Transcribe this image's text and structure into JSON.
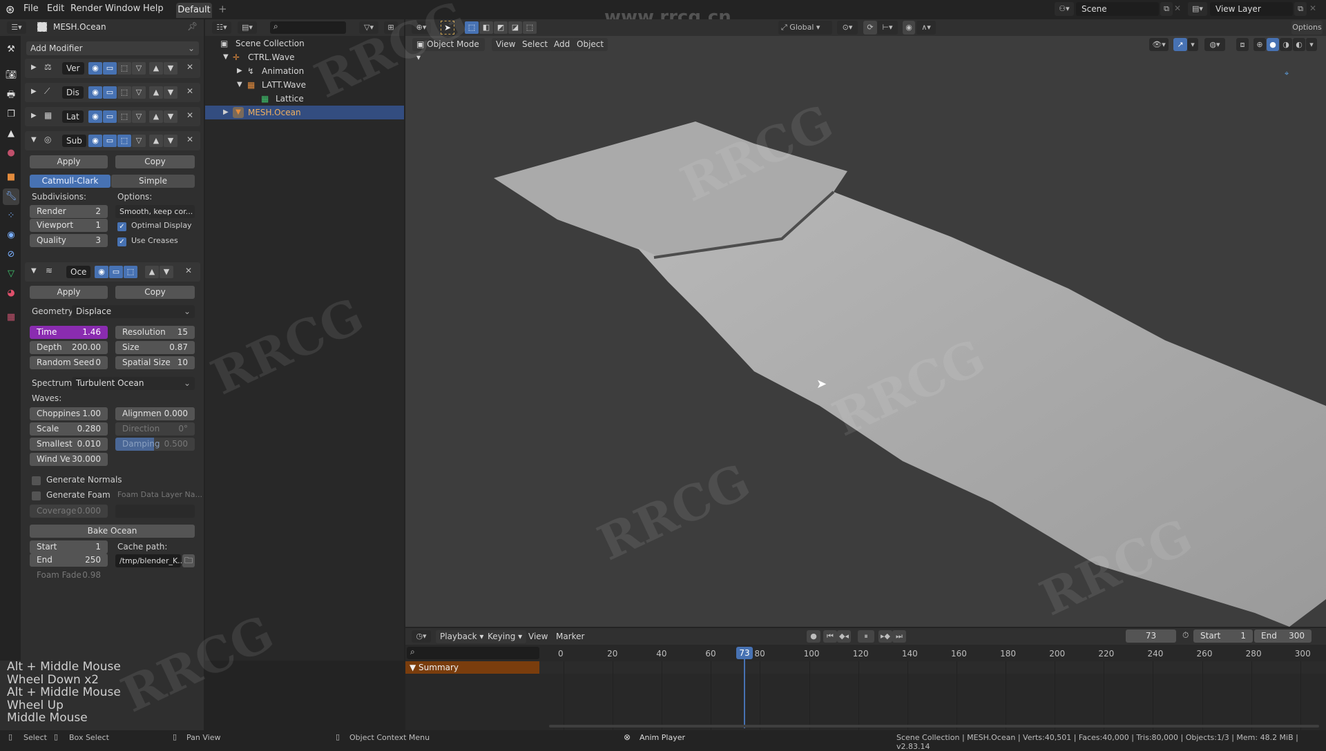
{
  "topbar": {
    "menus": [
      "File",
      "Edit",
      "Render",
      "Window",
      "Help"
    ],
    "workspace_tab": "Default",
    "add_workspace": "+",
    "scene": "Scene",
    "view_layer": "View Layer",
    "watermark_url": "www.rrcg.cn"
  },
  "properties": {
    "object_name": "MESH.Ocean",
    "add_modifier": "Add Modifier",
    "tabs": [
      "tool",
      "render",
      "output",
      "view-layer",
      "scene",
      "world",
      "object",
      "modifiers",
      "particles",
      "physics",
      "constraints",
      "data",
      "material",
      "texture"
    ],
    "modifiers": [
      {
        "name": "Ver",
        "icon": "vertex-weight-icon",
        "expanded": false
      },
      {
        "name": "Dis",
        "icon": "displace-icon",
        "expanded": false
      },
      {
        "name": "Lat",
        "icon": "lattice-icon",
        "expanded": false
      },
      {
        "name": "Sub",
        "icon": "subdivision-icon",
        "expanded": true
      },
      {
        "name": "Oce",
        "icon": "ocean-icon",
        "expanded": true
      }
    ],
    "subsurf": {
      "apply": "Apply",
      "copy": "Copy",
      "type_catmull": "Catmull-Clark",
      "type_simple": "Simple",
      "subdivisions_label": "Subdivisions:",
      "options_label": "Options:",
      "render_label": "Render",
      "render_value": "2",
      "viewport_label": "Viewport",
      "viewport_value": "1",
      "quality_label": "Quality",
      "quality_value": "3",
      "uv_smooth": "Smooth, keep cor...",
      "optimal_display": "Optimal Display",
      "use_creases": "Use Creases"
    },
    "ocean": {
      "apply": "Apply",
      "copy": "Copy",
      "geometry_label": "Geometry:",
      "geometry_value": "Displace",
      "time_label": "Time",
      "time_value": "1.46",
      "depth_label": "Depth",
      "depth_value": "200.00",
      "seed_label": "Random Seed",
      "seed_value": "0",
      "resolution_label": "Resolution",
      "resolution_value": "15",
      "size_label": "Size",
      "size_value": "0.87",
      "spatial_label": "Spatial Size",
      "spatial_value": "10",
      "spectrum_label": "Spectrum:",
      "spectrum_value": "Turbulent Ocean",
      "waves_label": "Waves:",
      "choppiness_label": "Choppines",
      "choppiness_value": "1.00",
      "scale_label": "Scale",
      "scale_value": "0.280",
      "smallest_label": "Smallest",
      "smallest_value": "0.010",
      "wind_label": "Wind Ve",
      "wind_value": "30.000",
      "alignment_label": "Alignmen",
      "alignment_value": "0.000",
      "direction_label": "Direction",
      "direction_value": "0°",
      "damping_label": "Damping",
      "damping_value": "0.500",
      "gen_normals": "Generate Normals",
      "gen_foam": "Generate Foam",
      "foam_layer_placeholder": "Foam Data Layer Na...",
      "coverage_label": "Coverage",
      "coverage_value": "0.000",
      "bake": "Bake Ocean",
      "start_label": "Start",
      "start_value": "1",
      "end_label": "End",
      "end_value": "250",
      "cache_label": "Cache path:",
      "cache_value": "/tmp/blender_K...",
      "foam_fade_label": "Foam Fade",
      "foam_fade_value": "0.98"
    }
  },
  "outliner": {
    "root": "Scene Collection",
    "items": [
      {
        "label": "CTRL.Wave",
        "depth": 1,
        "icon": "empty-icon"
      },
      {
        "label": "Animation",
        "depth": 2,
        "icon": "animation-icon"
      },
      {
        "label": "LATT.Wave",
        "depth": 2,
        "icon": "lattice-object-icon"
      },
      {
        "label": "Lattice",
        "depth": 3,
        "icon": "lattice-data-icon"
      },
      {
        "label": "MESH.Ocean",
        "depth": 1,
        "icon": "mesh-icon",
        "selected": true
      }
    ]
  },
  "viewport": {
    "mode": "Object Mode",
    "menus": [
      "View",
      "Select",
      "Add",
      "Object"
    ],
    "orientation": "Global",
    "options": "Options"
  },
  "timeline": {
    "menus": [
      "Playback",
      "Keying",
      "View",
      "Marker"
    ],
    "current_frame": "73",
    "start_label": "Start",
    "start_value": "1",
    "end_label": "End",
    "end_value": "300",
    "ticks": [
      "0",
      "20",
      "40",
      "60",
      "80",
      "100",
      "120",
      "140",
      "160",
      "180",
      "200",
      "220",
      "240",
      "260",
      "280",
      "300"
    ],
    "summary": "Summary"
  },
  "keylog": [
    "Alt + Middle Mouse",
    "Wheel Down x2",
    "Alt + Middle Mouse",
    "Wheel Up",
    "Middle Mouse"
  ],
  "statusbar": {
    "select": "Select",
    "box_select": "Box Select",
    "pan_view": "Pan View",
    "context_menu": "Object Context Menu",
    "anim_player": "Anim Player",
    "stats": "Scene Collection | MESH.Ocean | Verts:40,501 | Faces:40,000 | Tris:80,000 | Objects:1/3 | Mem: 48.2 MiB | v2.83.14"
  }
}
